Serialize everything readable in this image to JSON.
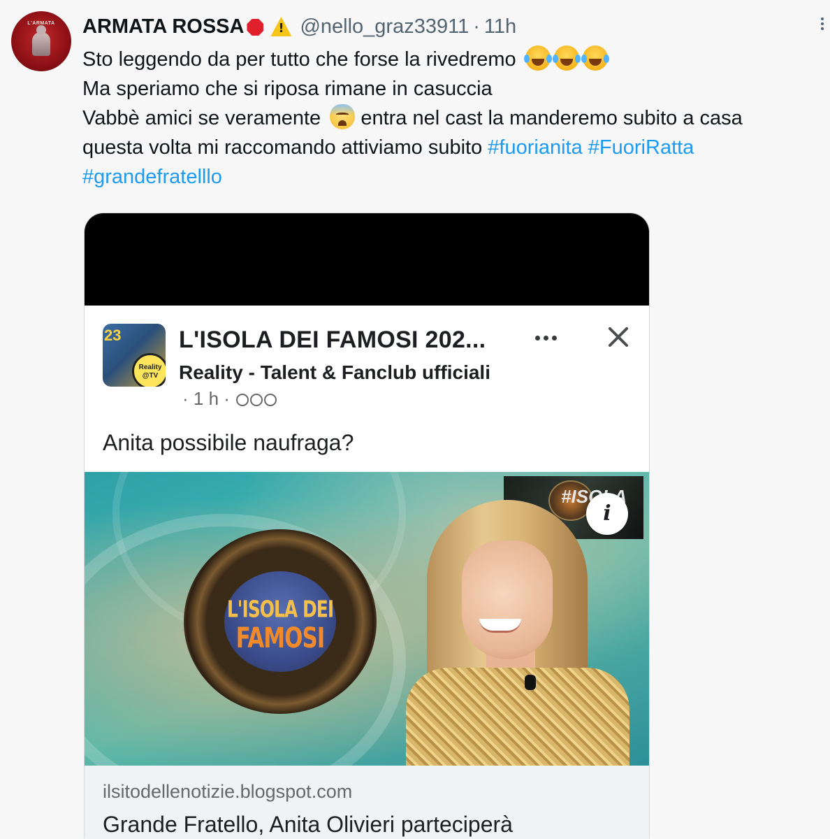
{
  "tweet": {
    "display_name": "ARMATA ROSSA",
    "handle": "@nello_graz33911",
    "separator": "·",
    "time": "11h",
    "avatar_text": "L'ARMATA",
    "lines": [
      "Sto leggendo da per tutto che forse la rivedremo",
      "Ma speriamo che si riposa rimane in casuccia",
      "Vabbè amici se veramente",
      "entra nel cast la manderemo subito a casa",
      "questa volta mi raccomando attiviamo subito"
    ],
    "hashtags": [
      "#fuorianita",
      "#FuoriRatta",
      "#grandefratelllo"
    ],
    "icons": [
      "stop-sign-icon",
      "warning-icon",
      "joy-emoji",
      "worried-emoji",
      "more-options-icon"
    ]
  },
  "embed": {
    "page_thumbnail_number": "23",
    "page_thumbnail_badge": "Reality\n@TV",
    "page_title": "L'ISOLA DEI FAMOSI 202...",
    "group_name": "Reality - Talent & Fanclub ufficiali",
    "meta": "· 1 h ·",
    "post_text": "Anita possibile naufraga?",
    "image": {
      "logo_line1": "L'ISOLA DEI",
      "logo_line2": "FAMOSI",
      "corner_tag": "#ISOLA",
      "info_label": "i"
    },
    "link_domain": "ilsitodellenotizie.blogspot.com",
    "link_title": "Grande Fratello, Anita Olivieri parteciperà",
    "colors": {
      "hashtag": "#1d9bf0",
      "fb_text": "#1c1e21",
      "fb_meta": "#65676b",
      "link_bg": "#f0f2f5"
    }
  }
}
